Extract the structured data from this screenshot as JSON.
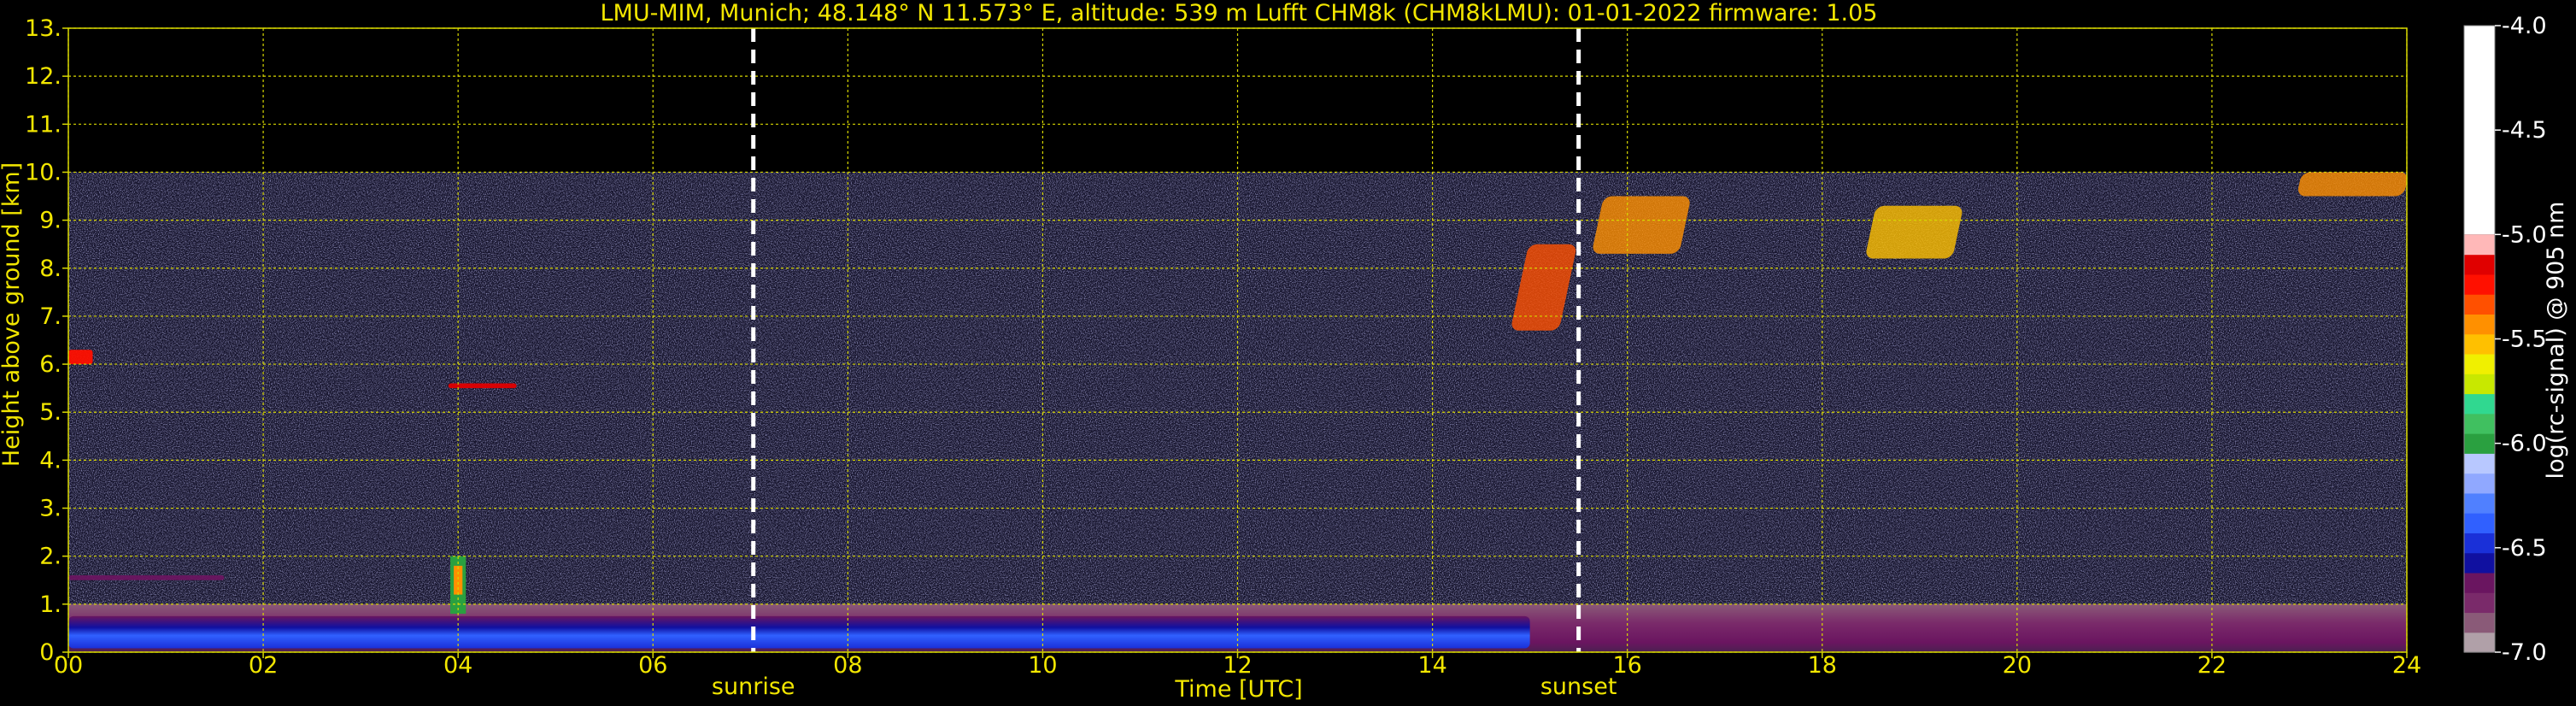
{
  "chart_data": {
    "type": "heatmap",
    "title": "LMU-MIM, Munich; 48.148° N 11.573° E, altitude: 539 m     Lufft CHM8k (CHM8kLMU): 01-01-2022     firmware: 1.05",
    "xlabel": "Time [UTC]",
    "ylabel": "Height above ground [km]",
    "xlim": [
      0,
      24
    ],
    "ylim": [
      0,
      13
    ],
    "x_ticks": [
      "00",
      "02",
      "04",
      "06",
      "08",
      "10",
      "12",
      "14",
      "16",
      "18",
      "20",
      "22",
      "24"
    ],
    "y_ticks": [
      "0.",
      "1.",
      "2.",
      "3.",
      "4.",
      "5.",
      "6.",
      "7.",
      "8.",
      "9.",
      "10.",
      "11.",
      "12.",
      "13."
    ],
    "grid": true,
    "data_top_km": 10,
    "colorbar": {
      "label": "log(rc-signal) @ 905 nm",
      "range": [
        -7.0,
        -4.0
      ],
      "ticks": [
        "-4.0",
        "-4.5",
        "-5.0",
        "-5.5",
        "-6.0",
        "-6.5",
        "-7.0"
      ],
      "colors": [
        "#b0a0a8",
        "#8a5a78",
        "#7a2a6a",
        "#6a1560",
        "#1010a0",
        "#1a30d8",
        "#3060ff",
        "#5080ff",
        "#90a8ff",
        "#b8c8ff",
        "#2aa040",
        "#40c060",
        "#30d890",
        "#c8e800",
        "#f0f000",
        "#ffc000",
        "#ff9000",
        "#ff5000",
        "#ff1000",
        "#e00000",
        "#ffb8b8",
        "#ffffff"
      ]
    },
    "annotations": [
      {
        "label": "sunrise",
        "x": 7.03
      },
      {
        "label": "sunset",
        "x": 15.5
      }
    ],
    "features": [
      {
        "name": "boundary-layer",
        "x_range": [
          0,
          24
        ],
        "y_range": [
          0.0,
          1.0
        ],
        "value": -6.6
      },
      {
        "name": "residual-layer",
        "x_range": [
          0,
          1.6
        ],
        "y_range": [
          1.5,
          1.6
        ],
        "value": -6.5
      },
      {
        "name": "low-cloud",
        "x": 4.0,
        "y_range": [
          0.8,
          2.0
        ],
        "value": -5.4
      },
      {
        "name": "mid-cloud",
        "x_range": [
          3.9,
          4.6
        ],
        "y_range": [
          5.5,
          5.6
        ],
        "value": -4.3
      },
      {
        "name": "mid-cloud",
        "x_range": [
          0,
          0.25
        ],
        "y_range": [
          6.0,
          6.3
        ],
        "value": -4.5
      },
      {
        "name": "cirrus",
        "x_range": [
          14.9,
          15.4
        ],
        "y_range": [
          6.7,
          8.5
        ],
        "value": -4.6
      },
      {
        "name": "cirrus",
        "x_range": [
          15.7,
          16.6
        ],
        "y_range": [
          8.3,
          9.5
        ],
        "value": -4.8
      },
      {
        "name": "cirrus",
        "x_range": [
          18.5,
          19.4
        ],
        "y_range": [
          8.2,
          9.3
        ],
        "value": -4.9
      },
      {
        "name": "cirrus",
        "x_range": [
          22.9,
          24
        ],
        "y_range": [
          9.5,
          10.0
        ],
        "value": -4.8
      }
    ]
  }
}
